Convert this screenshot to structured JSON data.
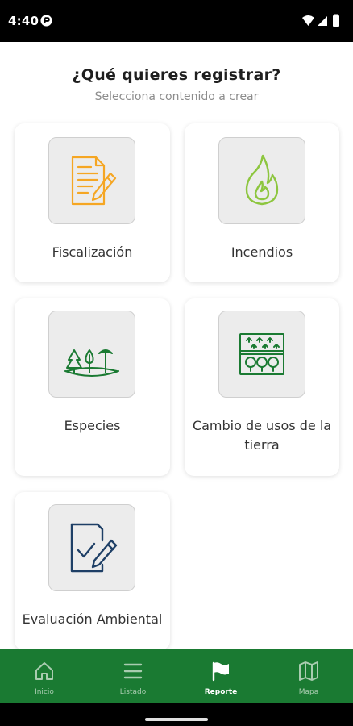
{
  "status_bar": {
    "time": "4:40"
  },
  "header": {
    "title": "¿Qué quieres registrar?",
    "subtitle": "Selecciona contenido a crear"
  },
  "cards": [
    {
      "label": "Fiscalización",
      "icon": "document-edit-icon",
      "color": "#f5a623"
    },
    {
      "label": "Incendios",
      "icon": "fire-icon",
      "color": "#8dc63f"
    },
    {
      "label": "Especies",
      "icon": "trees-icon",
      "color": "#1a7a32"
    },
    {
      "label": "Cambio de usos de la tierra",
      "icon": "land-use-grid-icon",
      "color": "#1a7a32"
    },
    {
      "label": "Evaluación Ambiental",
      "icon": "checklist-edit-icon",
      "color": "#1e3f66"
    }
  ],
  "bottom_nav": {
    "items": [
      {
        "label": "Inicio",
        "icon": "home-icon"
      },
      {
        "label": "Listado",
        "icon": "list-icon"
      },
      {
        "label": "Reporte",
        "icon": "flag-icon",
        "active": true
      },
      {
        "label": "Mapa",
        "icon": "map-icon"
      }
    ]
  },
  "colors": {
    "nav_background": "#1a7a32",
    "nav_active": "#ffffff",
    "nav_inactive": "#a9ccb0"
  }
}
